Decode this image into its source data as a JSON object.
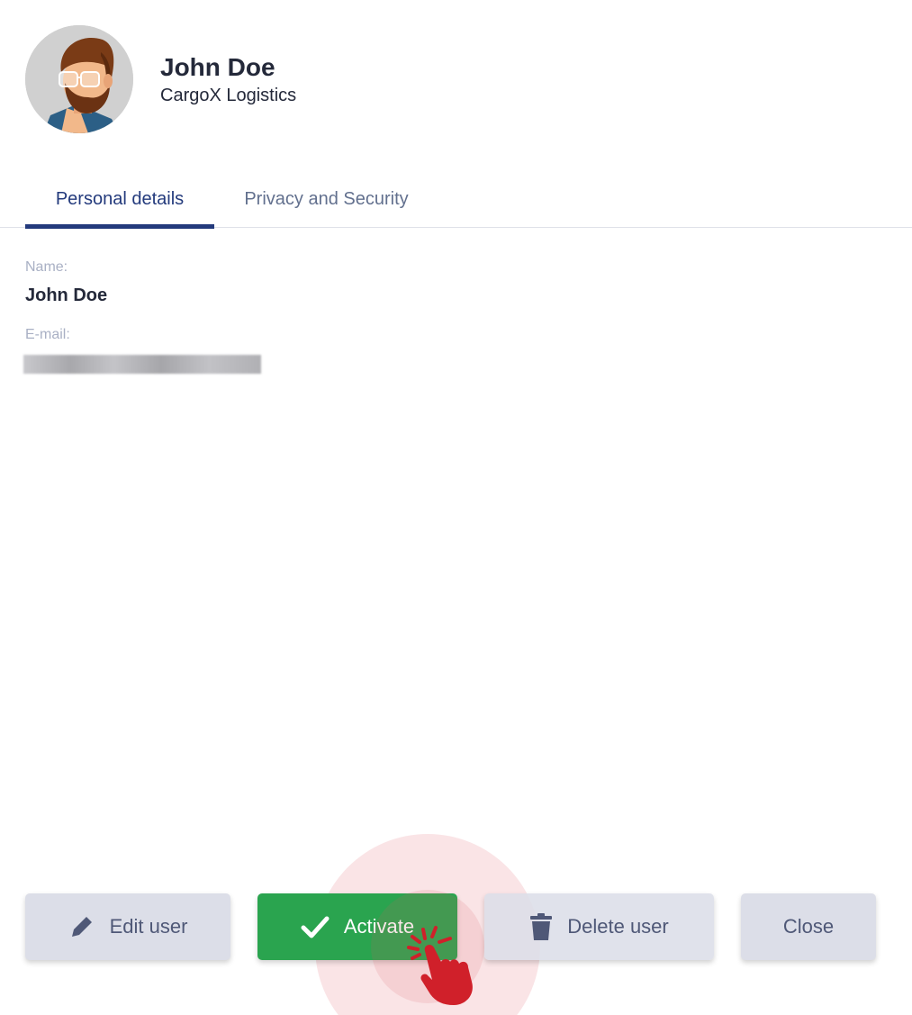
{
  "user": {
    "name": "John Doe",
    "company": "CargoX Logistics",
    "avatar_icon": "bearded-man-avatar"
  },
  "tabs": [
    {
      "label": "Personal details",
      "active": true
    },
    {
      "label": "Privacy and Security",
      "active": false
    }
  ],
  "details": {
    "name_label": "Name:",
    "name_value": "John Doe",
    "email_label": "E-mail:",
    "email_value_redacted": true
  },
  "actions": {
    "edit_label": "Edit user",
    "activate_label": "Activate",
    "delete_label": "Delete user",
    "close_label": "Close",
    "edit_icon": "pencil-icon",
    "activate_icon": "checkmark-icon",
    "delete_icon": "trash-icon"
  },
  "colors": {
    "accent": "#233a7c",
    "success": "#2aa44f",
    "button_grey": "#dcdee8",
    "click_indicator": "#d0202a"
  }
}
